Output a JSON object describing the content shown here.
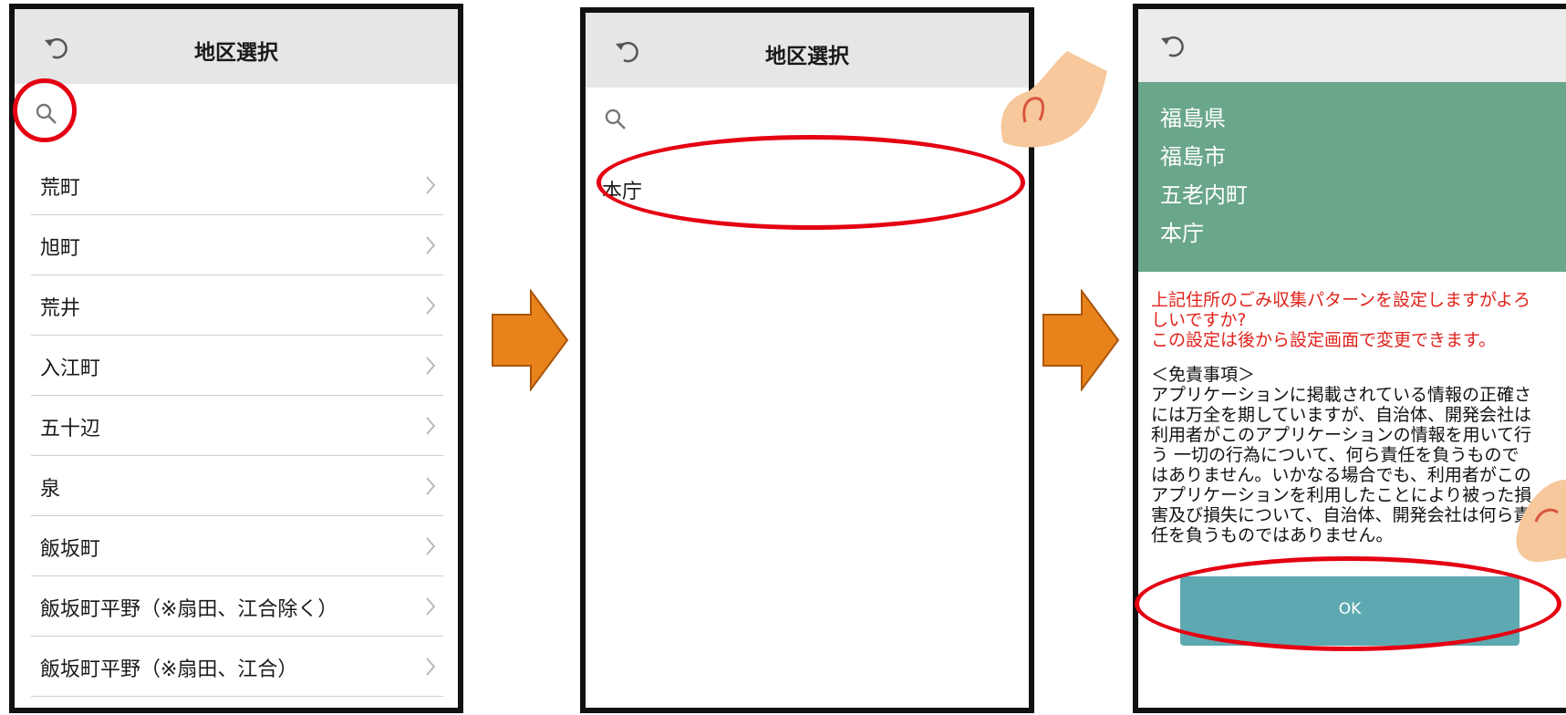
{
  "screen1": {
    "title": "地区選択",
    "items": [
      "荒町",
      "旭町",
      "荒井",
      "入江町",
      "五十辺",
      "泉",
      "飯坂町",
      "飯坂町平野（※扇田、江合除く）",
      "飯坂町平野（※扇田、江合）"
    ]
  },
  "screen2": {
    "title": "地区選択",
    "items": [
      "本庁"
    ]
  },
  "screen3": {
    "address": [
      "福島県",
      "福島市",
      "五老内町",
      "本庁"
    ],
    "confirm_lines": [
      "上記住所のごみ収集パターンを設定しますがよろ",
      "しいですか?",
      "この設定は後から設定画面で変更できます。"
    ],
    "disclaimer_lines": [
      "＜免責事項＞",
      "アプリケーションに掲載されている情報の正確さ",
      "には万全を期していますが、自治体、開発会社は",
      "利用者がこのアプリケーションの情報を用いて行",
      "う 一切の行為について、何ら責任を負うもので",
      "はありません。いかなる場合でも、利用者がこの",
      "アプリケーションを利用したことにより被った損",
      "害及び損失について、自治体、開発会社は何ら責",
      "任を負うものではありません。"
    ],
    "ok_label": "OK"
  },
  "colors": {
    "highlight_ring": "#e40012",
    "arrow": "#e8821a",
    "address_panel": "#6aa68a",
    "ok_button": "#5ea8b1",
    "confirm_text": "#e0231c"
  },
  "icons": [
    "undo-icon",
    "search-icon",
    "chevron-right-icon",
    "pointing-finger-icon",
    "right-arrow-icon"
  ]
}
